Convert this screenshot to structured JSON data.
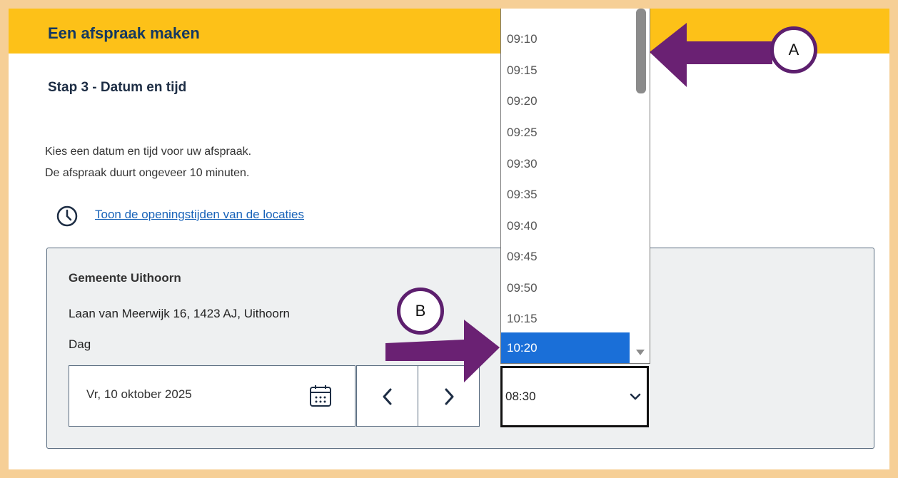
{
  "header": {
    "title": "Een afspraak maken"
  },
  "step": {
    "title": "Stap 3 - Datum en tijd"
  },
  "intro": {
    "line1": "Kies een datum en tijd voor uw afspraak.",
    "line2": "De afspraak duurt ongeveer 10 minuten."
  },
  "opening_hours_link": {
    "label": "Toon de openingstijden van de locaties",
    "icon": "clock-icon"
  },
  "location": {
    "name": "Gemeente Uithoorn",
    "address": "Laan van Meerwijk 16, 1423 AJ, Uithoorn",
    "day_label": "Dag",
    "date_value": "Vr, 10 oktober 2025",
    "date_icon": "calendar-icon",
    "prev_icon": "chevron-left-icon",
    "next_icon": "chevron-right-icon"
  },
  "time_select": {
    "value": "08:30",
    "icon": "chevron-down-icon"
  },
  "time_dropdown": {
    "options": [
      "09:10",
      "09:15",
      "09:20",
      "09:25",
      "09:30",
      "09:35",
      "09:40",
      "09:45",
      "09:50",
      "10:15",
      "10:20"
    ],
    "selected": "10:20"
  },
  "annotations": {
    "marker_a": "A",
    "marker_b": "B"
  },
  "colors": {
    "header_bg": "#fdc118",
    "frame_border": "#f6cf96",
    "link": "#1762b8",
    "selected_option": "#1a6fd8",
    "arrow": "#6a2173"
  }
}
